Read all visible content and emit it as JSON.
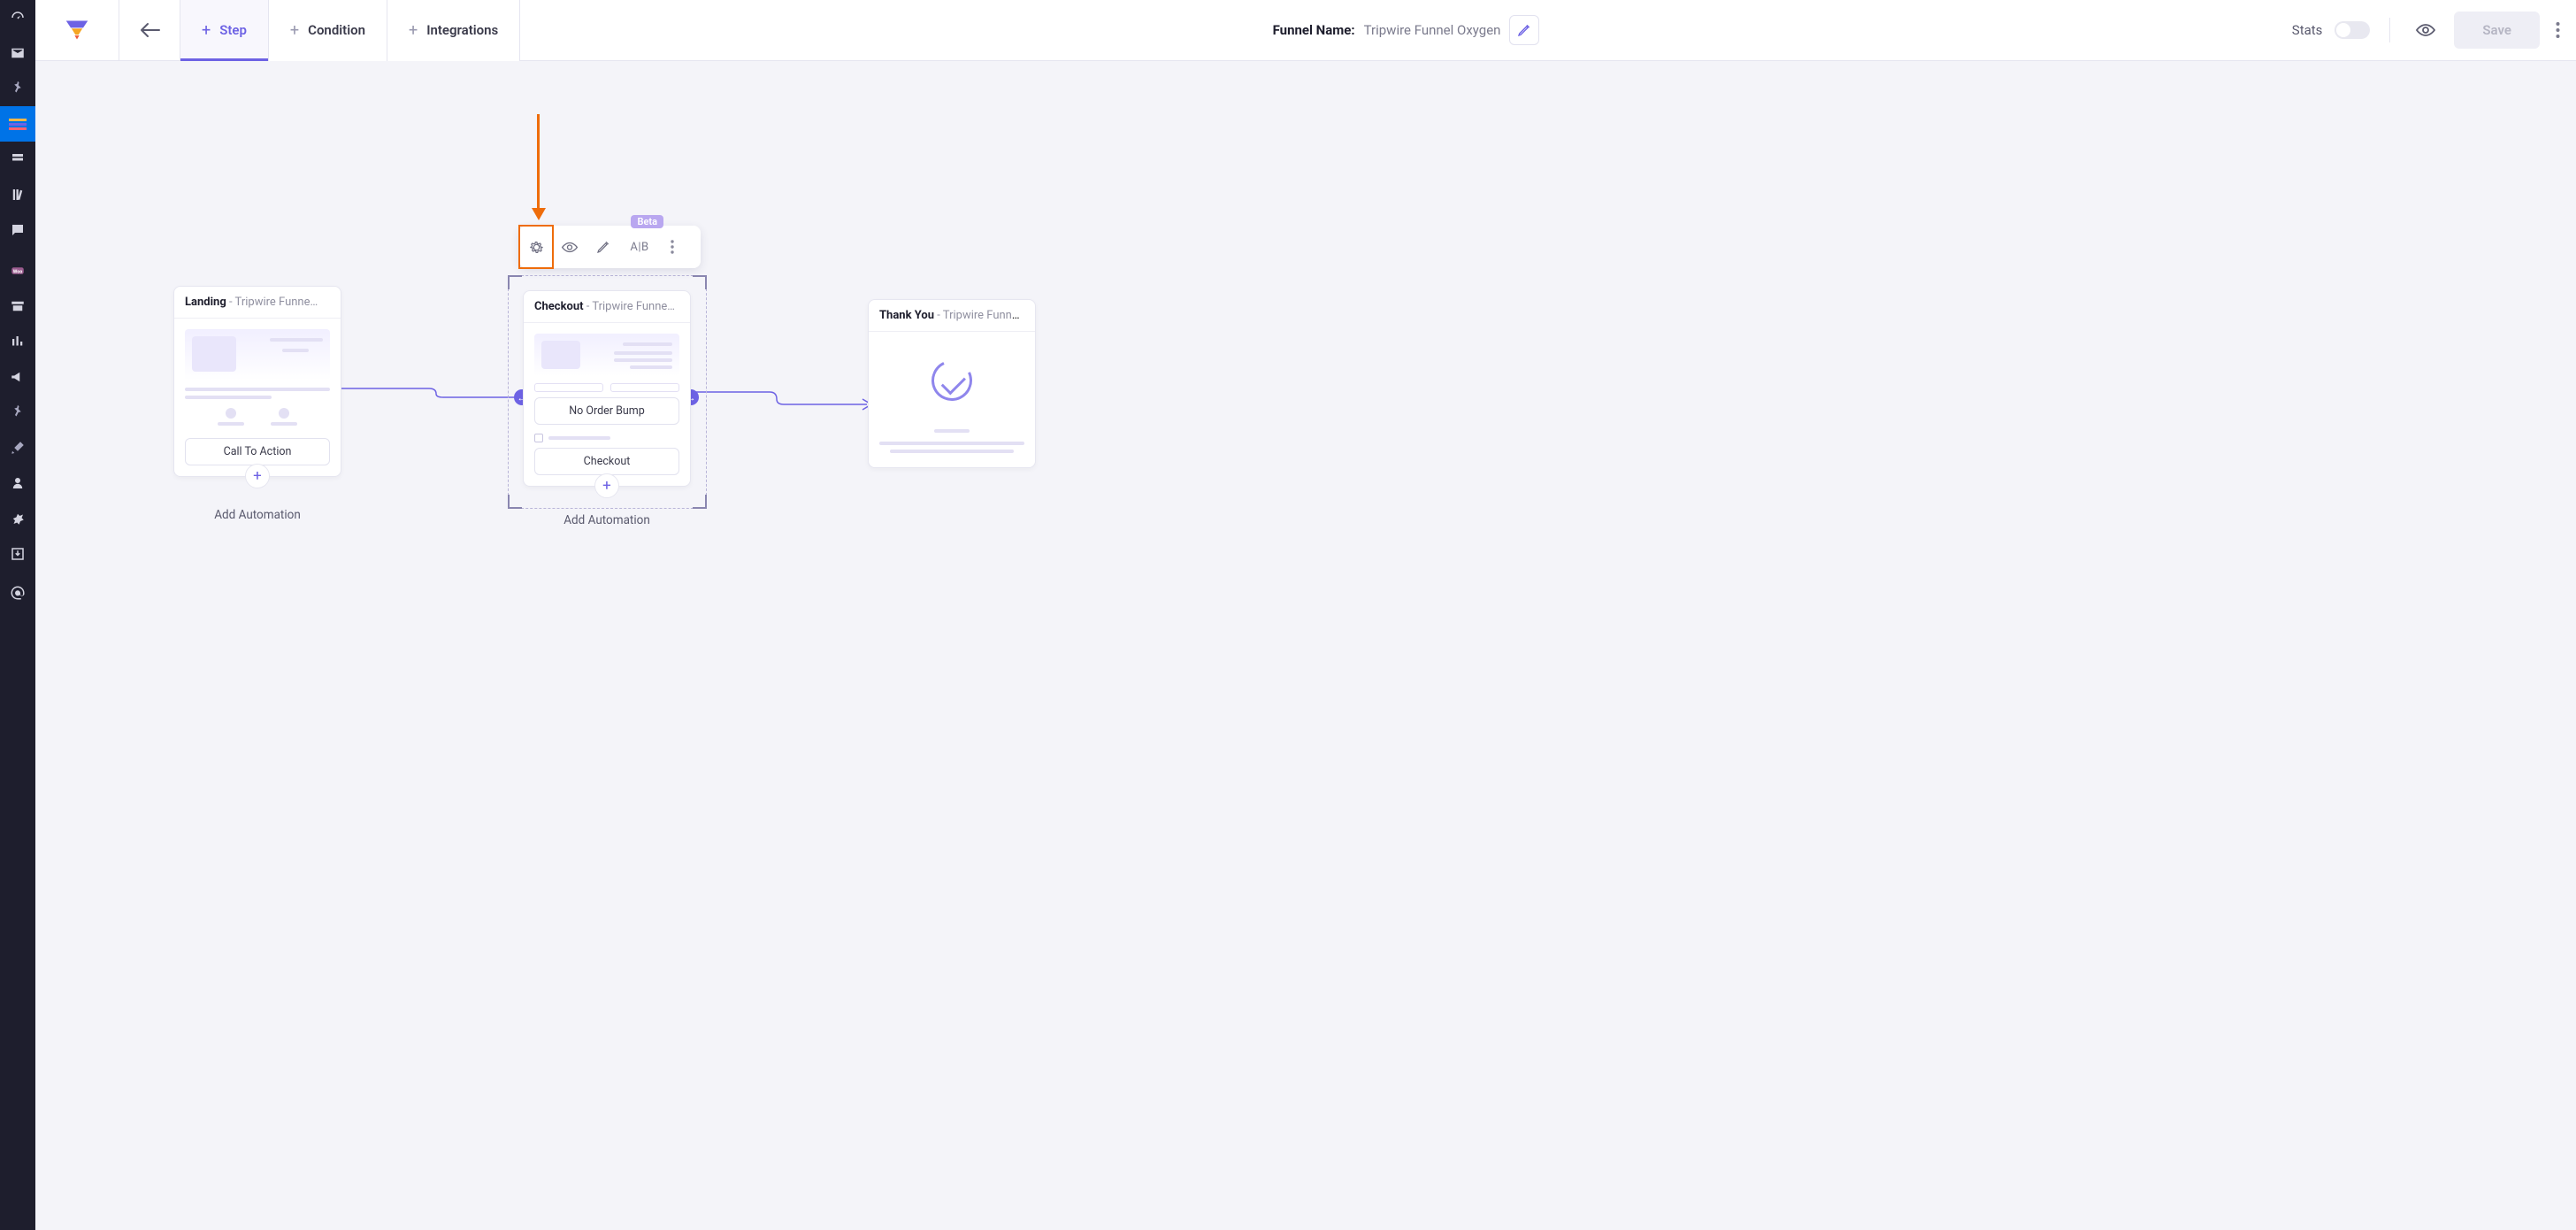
{
  "sidebar": {
    "activeIndex": 3
  },
  "topbar": {
    "tabs": {
      "step": "Step",
      "condition": "Condition",
      "integrations": "Integrations"
    },
    "funnelNameLabel": "Funnel Name:",
    "funnelNameValue": "Tripwire Funnel Oxygen",
    "statsLabel": "Stats",
    "saveLabel": "Save"
  },
  "toolbar": {
    "abLabel": "A|B",
    "betaLabel": "Beta"
  },
  "nodes": {
    "landing": {
      "title": "Landing",
      "subtitle": " - Tripwire Funne…",
      "cta": "Call To Action",
      "addAutomation": "Add Automation"
    },
    "checkout": {
      "title": "Checkout",
      "subtitle": " - Tripwire Funne…",
      "orderBump": "No Order Bump",
      "checkoutLabel": "Checkout",
      "addAutomation": "Add Automation"
    },
    "thankyou": {
      "title": "Thank You",
      "subtitle": " - Tripwire Funne…"
    }
  },
  "colors": {
    "accent": "#6d62e4",
    "highlight": "#ee6c0b"
  }
}
